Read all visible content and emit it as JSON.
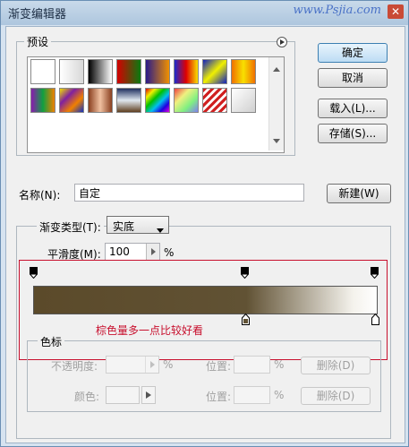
{
  "window": {
    "title": "渐变编辑器",
    "watermark": "www.Psjia.com",
    "close_glyph": "✕"
  },
  "presets": {
    "label": "预设",
    "swatches": [
      {
        "id": "fg-bg",
        "bg": "linear-gradient(to right,#ffffff,#ffffff)"
      },
      {
        "id": "fg-transparent",
        "bg": "linear-gradient(to right,#ffffff,#d8d8d8)"
      },
      {
        "id": "black-white",
        "bg": "linear-gradient(to right,#000000,#ffffff)"
      },
      {
        "id": "red-green",
        "bg": "linear-gradient(to right,#d40000,#0a7a10)"
      },
      {
        "id": "violet-orange",
        "bg": "linear-gradient(to right,#2a1a8a,#f09000)"
      },
      {
        "id": "blue-red-yellow",
        "bg": "linear-gradient(to right,#1a2ad0,#e00000,#f8e000)"
      },
      {
        "id": "blue-yellow-blue",
        "bg": "linear-gradient(135deg,#1020c0,#f0f000,#1020c0)"
      },
      {
        "id": "orange-yellow-orange",
        "bg": "linear-gradient(to right,#f07000,#f8e000,#f07000)"
      },
      {
        "id": "violet-green-orange",
        "bg": "linear-gradient(to right,#8a1ab0,#10a040,#f08000)"
      },
      {
        "id": "yellow-violet-orange-blue",
        "bg": "linear-gradient(135deg,#f0e000,#8020a0,#f08000,#1030c0)"
      },
      {
        "id": "copper",
        "bg": "linear-gradient(to right,#8a4020,#f0c0a0,#8a4020)"
      },
      {
        "id": "chrome",
        "bg": "linear-gradient(to bottom,#203060,#e0e8f0,#604020)"
      },
      {
        "id": "spectrum",
        "bg": "linear-gradient(135deg,#e00000,#f0f000,#00c000,#00c0f0,#2000e0,#e000e0)"
      },
      {
        "id": "transparent-rainbow",
        "bg": "linear-gradient(135deg,#f04040,#f0f080,#80f080,#8080f0)"
      },
      {
        "id": "transparent-stripes",
        "bg": "repeating-linear-gradient(135deg,#d02020 0 3px,#ffffff 3px 6px)"
      },
      {
        "id": "neutral-density",
        "bg": "linear-gradient(135deg,#ffffff,#d0d0d0)"
      }
    ]
  },
  "buttons": {
    "ok": "确定",
    "cancel": "取消",
    "load": "载入(L)...",
    "save": "存储(S)...",
    "new": "新建(W)"
  },
  "name": {
    "label": "名称(N):",
    "value": "自定"
  },
  "gradient_type": {
    "label": "渐变类型(T):",
    "value": "实底"
  },
  "smoothness": {
    "label": "平滑度(M):",
    "value": "100",
    "unit": "%"
  },
  "gradient": {
    "colors": [
      "#5b4a2a",
      "#615234",
      "#f4f2ec",
      "#ffffff"
    ],
    "midpoint_percent": 62
  },
  "annotation": {
    "text": "棕色量多一点比较好看",
    "color": "#c8102e"
  },
  "stops": {
    "label": "色标",
    "opacity_label": "不透明度:",
    "location_label": "位置:",
    "percent": "%",
    "color_label": "颜色:",
    "delete_label": "删除(D)"
  }
}
